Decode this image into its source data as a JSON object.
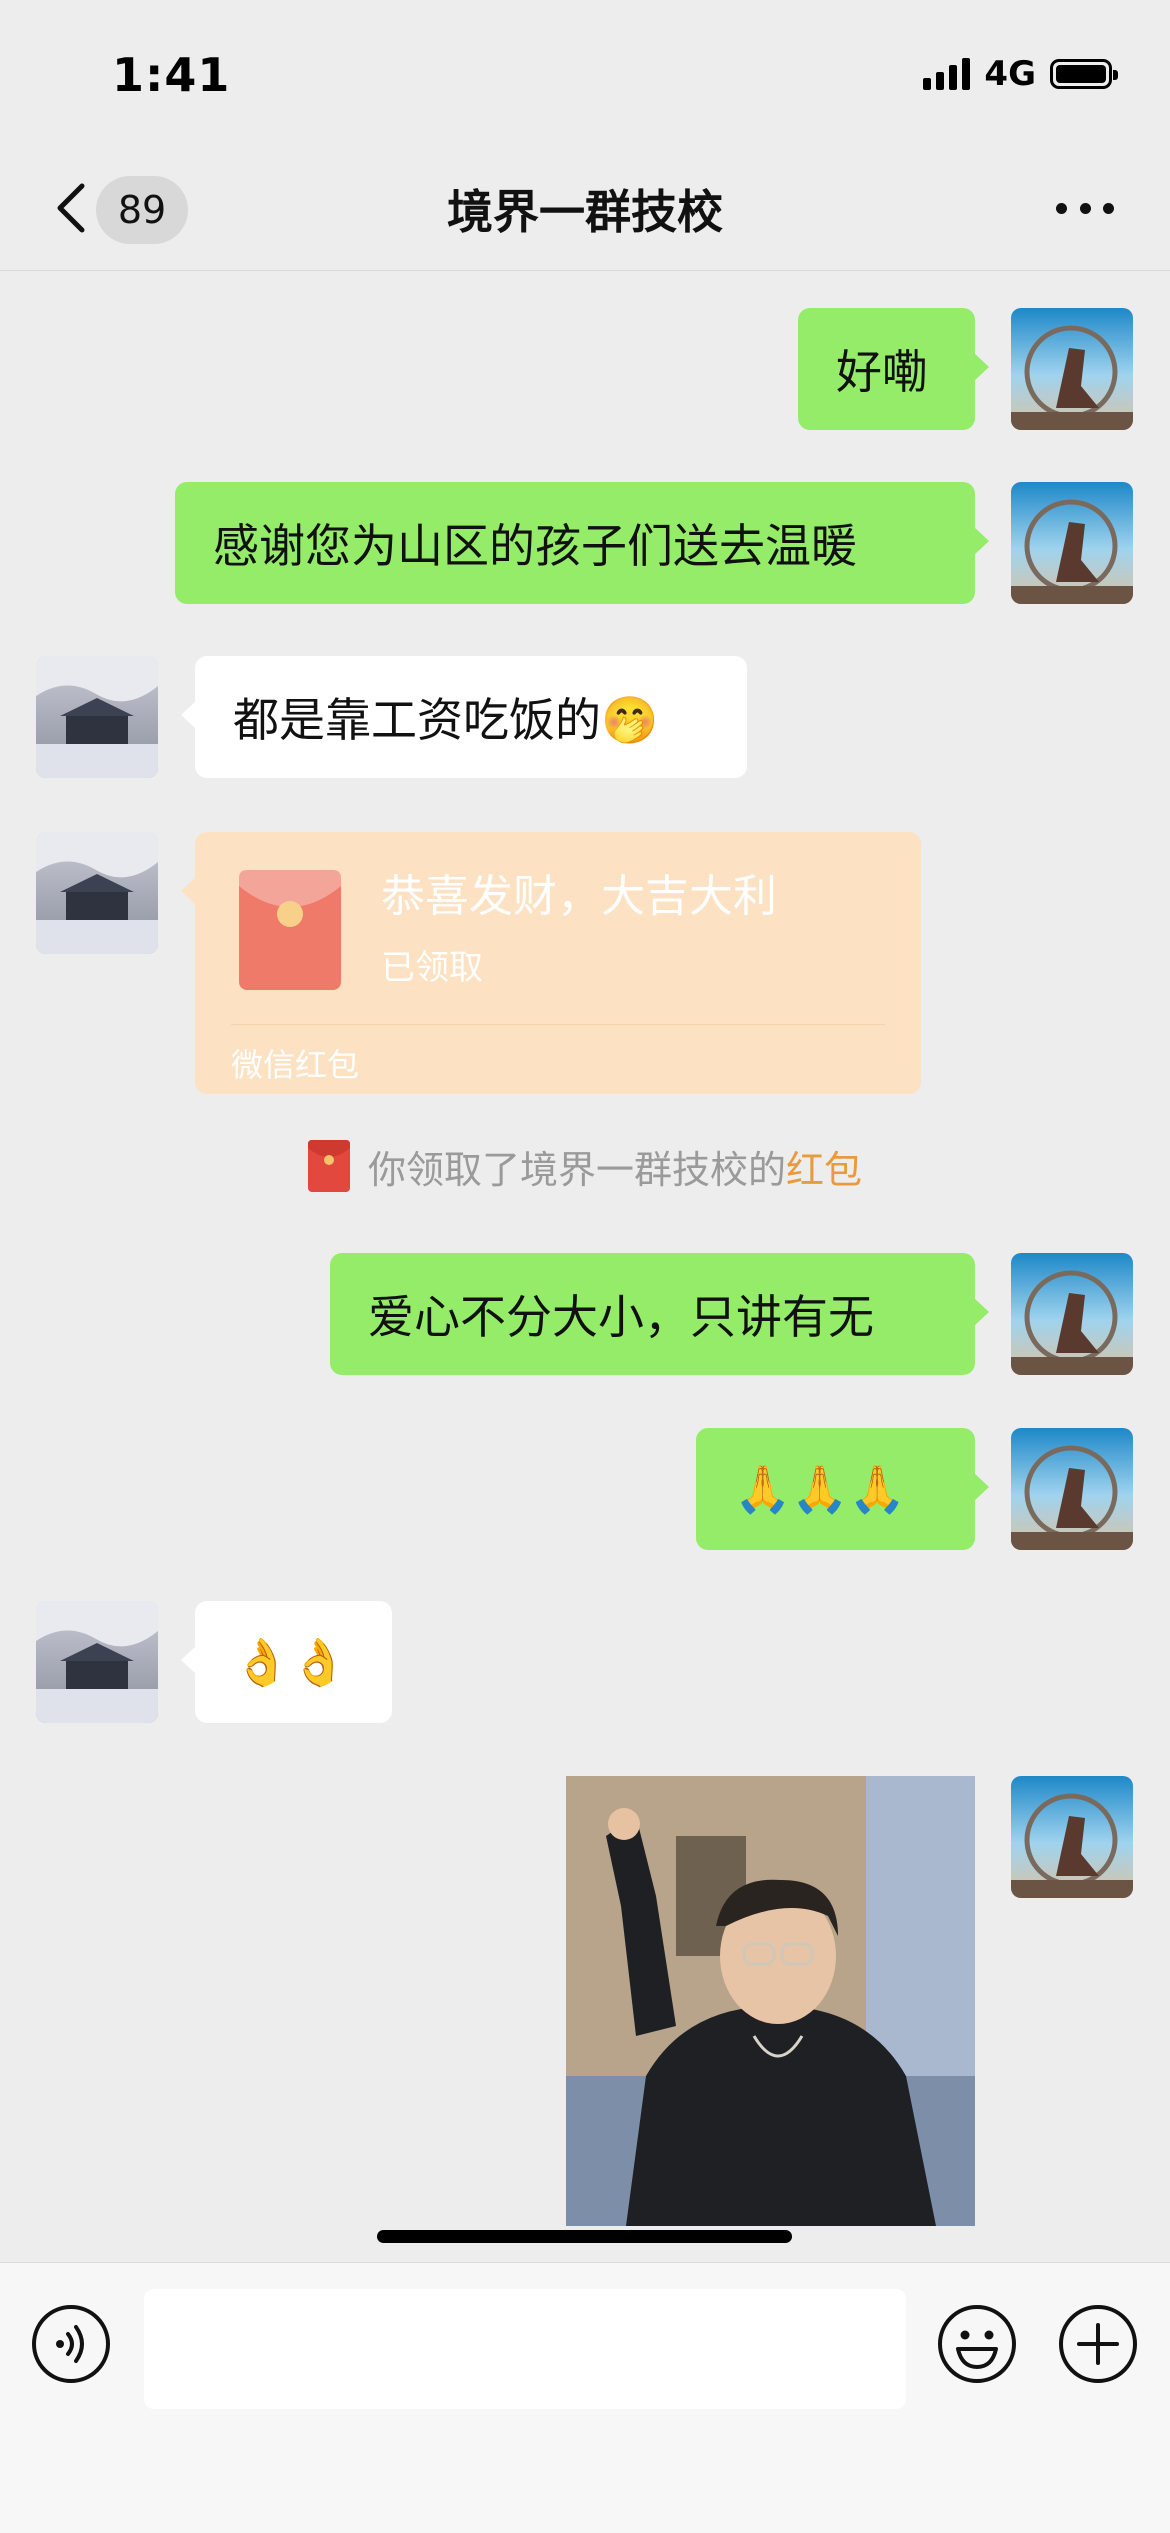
{
  "status_bar": {
    "time": "1:41",
    "network": "4G"
  },
  "nav": {
    "unread_count": "89",
    "title": "境界一群技校",
    "back_icon": "chevron-left-icon",
    "more_icon": "more-dots-icon"
  },
  "messages": [
    {
      "id": "m1",
      "side": "self",
      "text": "好嘞"
    },
    {
      "id": "m2",
      "side": "self",
      "text": "感谢您为山区的孩子们送去温暖"
    },
    {
      "id": "m3",
      "side": "other",
      "text": "都是靠工资吃饭的🤭"
    },
    {
      "id": "m4",
      "side": "other",
      "type": "red_packet",
      "title": "恭喜发财，大吉大利",
      "status": "已领取",
      "brand": "微信红包"
    },
    {
      "id": "m5",
      "side": "self",
      "text": "爱心不分大小，只讲有无"
    },
    {
      "id": "m6",
      "side": "self",
      "text": "🙏🙏🙏"
    },
    {
      "id": "m7",
      "side": "other",
      "text": "👌👌"
    },
    {
      "id": "m8",
      "side": "self",
      "type": "image"
    }
  ],
  "system": {
    "text": "你领取了境界一群技校的",
    "link": "红包"
  },
  "colors": {
    "self_bubble": "#95ec69",
    "other_bubble": "#ffffff",
    "background": "#ededed",
    "red_packet": "#fce2c3",
    "link": "#e99a3a"
  },
  "input_bar": {
    "placeholder": "",
    "voice_icon": "voice-icon",
    "emoji_icon": "emoji-icon",
    "plus_icon": "plus-icon"
  }
}
